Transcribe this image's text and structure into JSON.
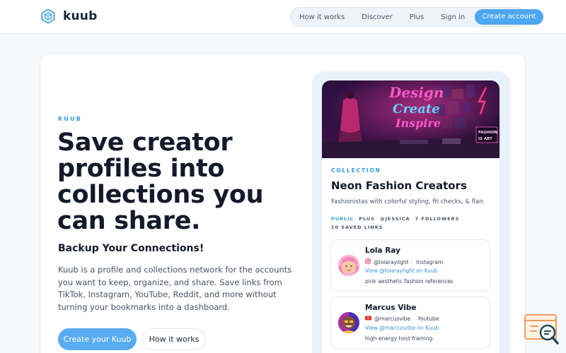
{
  "header": {
    "brand": "kuub",
    "nav": [
      "How it works",
      "Discover",
      "Plus",
      "Sign in"
    ],
    "cta": "Create account"
  },
  "hero": {
    "eyebrow": "KUUB",
    "headline": "Save creator profiles into collections you can share.",
    "subhead": "Backup Your Connections!",
    "description": "Kuub is a profile and collections network for the accounts you want to keep, organize, and share. Save links from TikTok, Instagram, YouTube, Reddit, and more without turning your bookmarks into a dashboard.",
    "primary_cta": "Create your Kuub",
    "secondary_cta": "How it works"
  },
  "collection": {
    "cover_text": [
      "Design",
      "Create",
      "Inspire"
    ],
    "cover_sign": [
      "FASHION",
      "IS ART"
    ],
    "label": "COLLECTION",
    "title": "Neon Fashion Creators",
    "description": "Fashionistas with colorful styling, fit checks, & flair.",
    "visibility": "PUBLIC",
    "tier": "PLUS",
    "owner": "@JESSICA",
    "followers": "7 FOLLOWERS",
    "saved": "10 SAVED LINKS",
    "profiles": [
      {
        "name": "Lola Ray",
        "handle": "@lolaraylight",
        "platform": "Instagram",
        "platform_icon": "instagram-icon",
        "link": "View @lolaraylight on Kuub",
        "note": "pink aesthetic fashion references"
      },
      {
        "name": "Marcus Vibe",
        "handle": "@marcusvibe",
        "platform": "Youtube",
        "platform_icon": "youtube-icon",
        "link": "View @marcusvibe on Kuub",
        "note": "high-energy host framing"
      }
    ]
  },
  "colors": {
    "accent": "#4da6ef",
    "eyebrow": "#2f9be0",
    "ink": "#141a2b"
  }
}
